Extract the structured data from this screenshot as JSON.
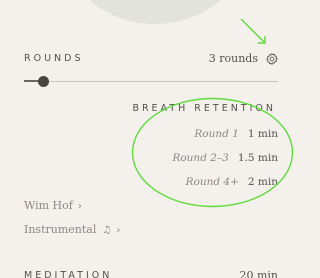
{
  "rounds": {
    "label": "ROUNDS",
    "value": "3 rounds",
    "slider_fraction": 0.08
  },
  "breath_retention": {
    "title": "BREATH RETENTION",
    "rows": [
      {
        "round": "Round 1",
        "time": "1 min"
      },
      {
        "round": "Round 2–3",
        "time": "1.5 min"
      },
      {
        "round": "Round 4+",
        "time": "2 min"
      }
    ]
  },
  "music": {
    "items": [
      {
        "label": "Wim Hof",
        "chevron": "›"
      },
      {
        "label": "Instrumental",
        "icon": "♫",
        "chevron": "›"
      }
    ]
  },
  "meditation": {
    "label": "MEDITATION",
    "value": "20 min"
  },
  "icons": {
    "settings": "gear-icon",
    "note": "music-note-icon",
    "chevron": "chevron-right-icon"
  },
  "colors": {
    "background": "#f4f0ec",
    "annotation": "#5fdc3c",
    "slider_thumb": "#494541"
  }
}
